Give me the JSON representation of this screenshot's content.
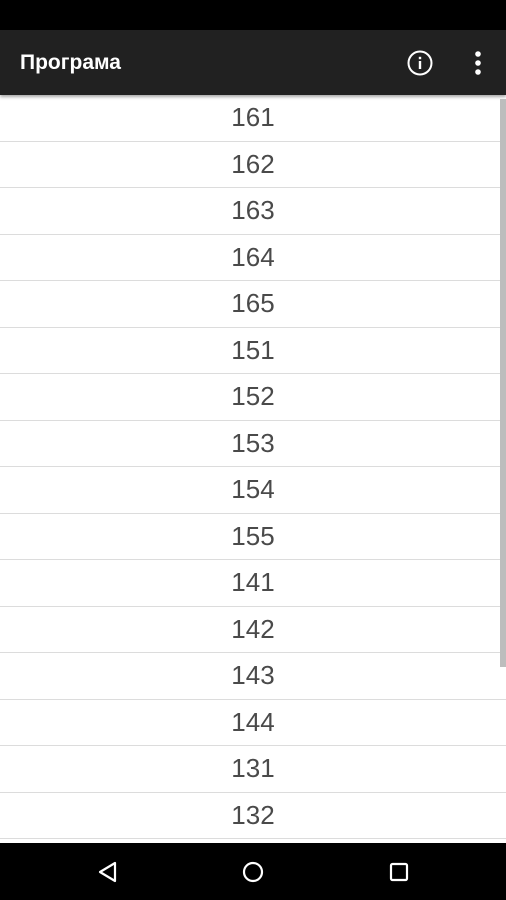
{
  "app_bar": {
    "title": "Програма",
    "info_icon": "info-icon",
    "more_icon": "more-vert-icon"
  },
  "list": {
    "items": [
      "161",
      "162",
      "163",
      "164",
      "165",
      "151",
      "152",
      "153",
      "154",
      "155",
      "141",
      "142",
      "143",
      "144",
      "131",
      "132"
    ]
  },
  "nav_bar": {
    "icons": [
      "back-triangle-icon",
      "home-circle-icon",
      "recents-square-icon"
    ]
  },
  "colors": {
    "app_bar": "#212121",
    "status_bar": "#000000",
    "nav_bar": "#000000",
    "list_text": "#4a4a4a",
    "divider": "#dcdcdc"
  }
}
